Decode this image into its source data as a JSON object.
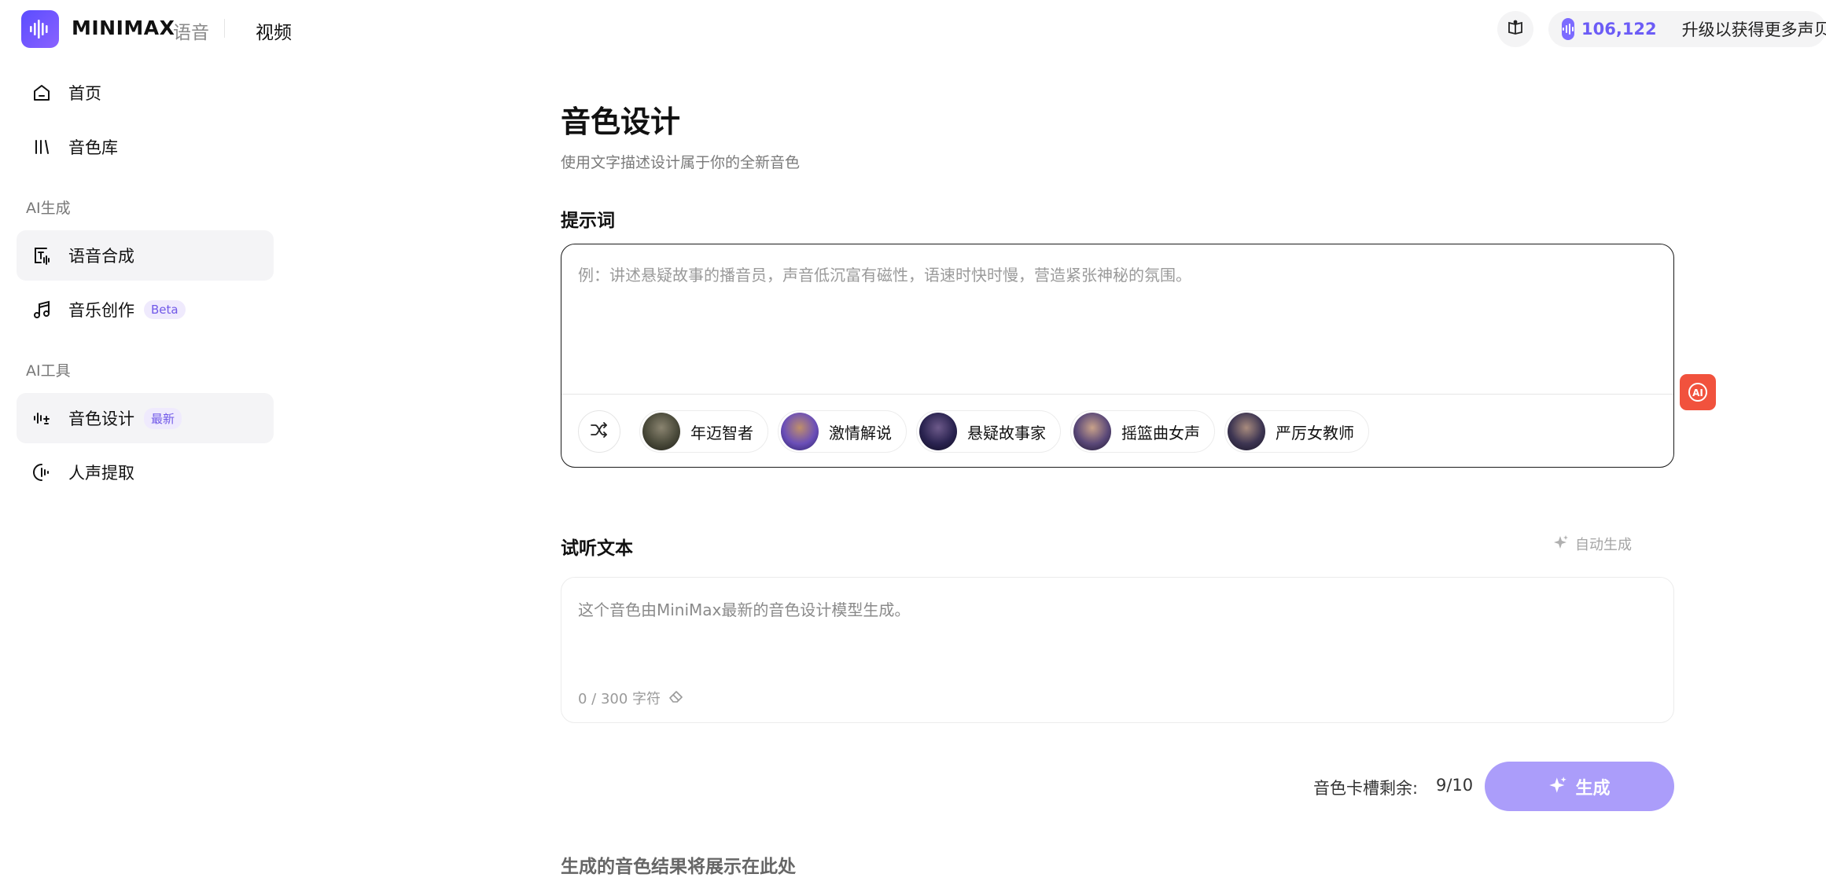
{
  "header": {
    "brand": "MINIMAX",
    "nav_voice": "语音",
    "nav_video": "视频",
    "credits": "106,122",
    "upgrade": "升级以获得更多声贝",
    "icons": [
      "waveform-logo-icon",
      "book-icon",
      "coin-icon"
    ]
  },
  "sidebar": {
    "items_top": [
      {
        "label": "首页",
        "icon": "home-icon"
      },
      {
        "label": "音色库",
        "icon": "library-icon"
      }
    ],
    "section_ai_gen": "AI生成",
    "items_gen": [
      {
        "label": "语音合成",
        "icon": "text-to-speech-icon",
        "active": true
      },
      {
        "label": "音乐创作",
        "icon": "music-note-icon",
        "badge": "Beta"
      }
    ],
    "section_ai_tools": "AI工具",
    "items_tools": [
      {
        "label": "音色设计",
        "icon": "voice-design-icon",
        "active": true,
        "badge": "最新"
      },
      {
        "label": "人声提取",
        "icon": "voice-extract-icon"
      }
    ]
  },
  "main": {
    "title": "音色设计",
    "subtitle": "使用文字描述设计属于你的全新音色",
    "prompt_label": "提示词",
    "prompt_placeholder": "例：讲述悬疑故事的播音员，声音低沉富有磁性，语速时快时慢，营造紧张神秘的氛围。",
    "presets": [
      {
        "label": "年迈智者",
        "avatar_color": "#4a4a3a"
      },
      {
        "label": "激情解说",
        "avatar_color": "#6b4fb8"
      },
      {
        "label": "悬疑故事家",
        "avatar_color": "#2a2350"
      },
      {
        "label": "摇篮曲女声",
        "avatar_color": "#5a4878"
      },
      {
        "label": "严厉女教师",
        "avatar_color": "#3d3552"
      }
    ],
    "preview_label": "试听文本",
    "auto_generate": "自动生成",
    "preview_text": "这个音色由MiniMax最新的音色设计模型生成。",
    "char_count": "0 / 300 字符",
    "slots_label": "音色卡槽剩余:",
    "slots_value": "9/10",
    "generate_label": "生成",
    "result_placeholder": "生成的音色结果将展示在此处",
    "ai_fab": "AI"
  },
  "colors": {
    "accent": "#6c5cf6",
    "generate_button": "#ab9dfa",
    "ai_fab": "#f1523d"
  }
}
